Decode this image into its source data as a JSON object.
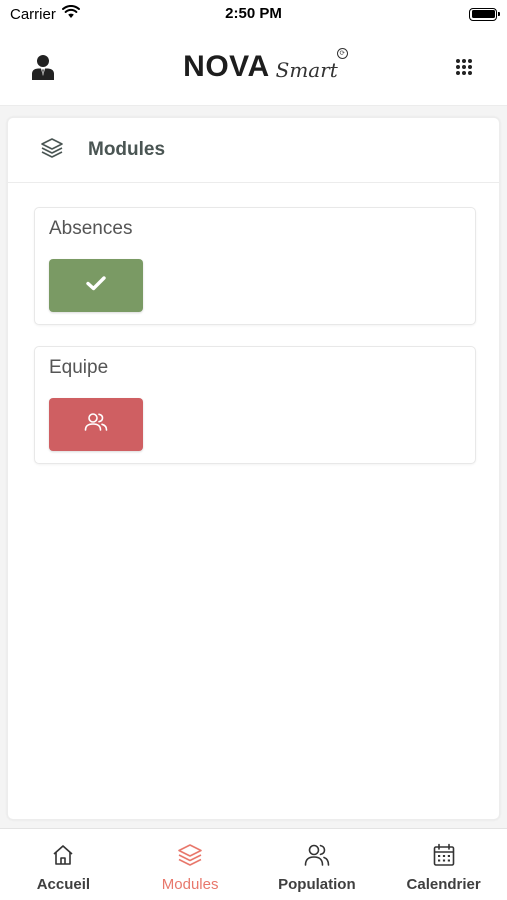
{
  "status_bar": {
    "carrier": "Carrier",
    "time": "2:50 PM"
  },
  "header": {
    "logo_main": "NOVA",
    "logo_sub": "Smart",
    "user_icon": "user-icon",
    "apps_icon": "grid-icon"
  },
  "page": {
    "title": "Modules",
    "title_icon": "layers-icon"
  },
  "modules": [
    {
      "label": "Absences",
      "icon": "check-icon",
      "color": "#7a9a64"
    },
    {
      "label": "Equipe",
      "icon": "users-icon",
      "color": "#cf5f62"
    }
  ],
  "bottom_nav": {
    "active_color": "#e8786c",
    "items": [
      {
        "label": "Accueil",
        "icon": "home-icon"
      },
      {
        "label": "Modules",
        "icon": "layers-icon",
        "active": true
      },
      {
        "label": "Population",
        "icon": "users-icon"
      },
      {
        "label": "Calendrier",
        "icon": "calendar-icon"
      }
    ]
  }
}
